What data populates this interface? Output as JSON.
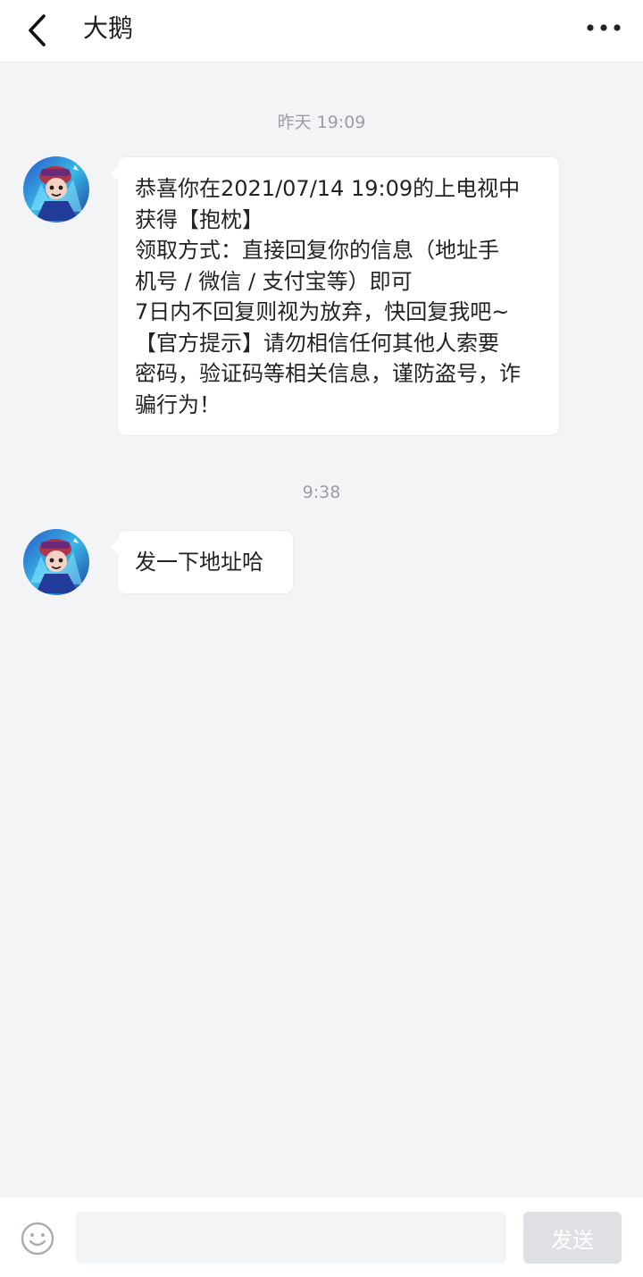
{
  "header": {
    "title": "大鹅",
    "back_icon": "chevron-left-icon",
    "more_icon": "more-horizontal-icon"
  },
  "messages": [
    {
      "timestamp": "昨天 19:09",
      "lines": [
        "恭喜你在2021/07/14 19:09的上电视中",
        "获得【抱枕】",
        "领取方式：直接回复你的信息（地址手",
        "机号 / 微信 / 支付宝等）即可",
        "7日内不回复则视为放弃，快回复我吧~",
        "【官方提示】请勿相信任何其他人索要",
        "密码，验证码等相关信息，谨防盗号，诈",
        "骗行为！"
      ]
    },
    {
      "timestamp": "9:38",
      "lines": [
        "发一下地址哈"
      ]
    }
  ],
  "footer": {
    "emoji_icon": "emoji-smile-icon",
    "input_value": "",
    "input_placeholder": "",
    "send_label": "发送"
  },
  "colors": {
    "background": "#f3f4f6",
    "bubble": "#ffffff",
    "send_disabled": "#dfe0e3"
  }
}
